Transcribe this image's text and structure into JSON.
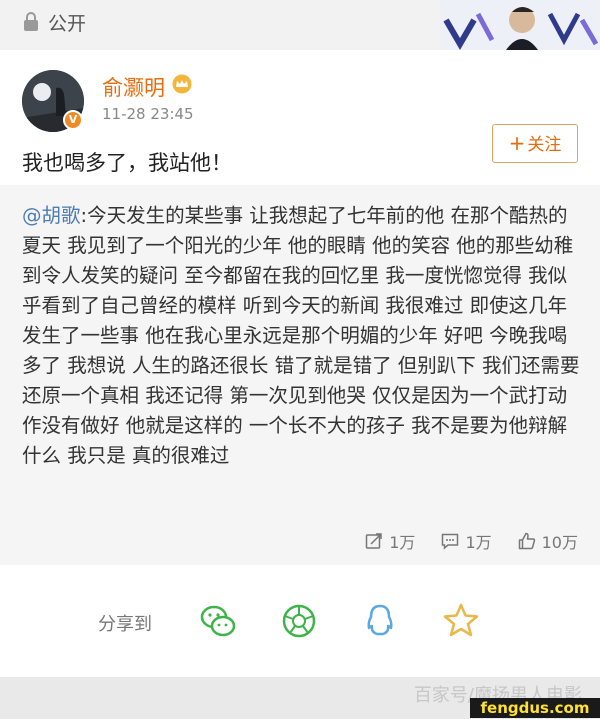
{
  "header": {
    "visibility_label": "公开"
  },
  "post": {
    "username": "俞灏明",
    "time": "11-28 23:45",
    "follow_label": "关注",
    "follow_plus": "+",
    "avatar_badge": "V",
    "text": "我也喝多了，我站他！"
  },
  "repost": {
    "mention": "@胡歌",
    "text": ":今天发生的某些事 让我想起了七年前的他 在那个酷热的夏天 我见到了一个阳光的少年 他的眼睛 他的笑容 他的那些幼稚到令人发笑的疑问 至今都留在我的回忆里 我一度恍惚觉得 我似乎看到了自己曾经的模样 听到今天的新闻 我很难过 即使这几年发生了一些事 他在我心里永远是那个明媚的少年 好吧 今晚我喝多了 我想说 人生的路还很长 错了就是错了 但别趴下 我们还需要还原一个真相 我还记得 第一次见到他哭 仅仅是因为一个武打动作没有做好 他就是这样的 一个长不大的孩子 我不是要为他辩解什么 我只是 真的很难过",
    "stats": {
      "reposts": "1万",
      "comments": "1万",
      "likes": "10万"
    }
  },
  "share": {
    "label": "分享到"
  },
  "watermark": {
    "line1": "百家号/魔扬男人电影",
    "site": "fengdus.com"
  },
  "colors": {
    "username": "#e86b0c",
    "mention": "#4d7db3",
    "share_green": "#3db34a",
    "share_blue": "#5aa8e0",
    "share_gold": "#e8b84a"
  }
}
